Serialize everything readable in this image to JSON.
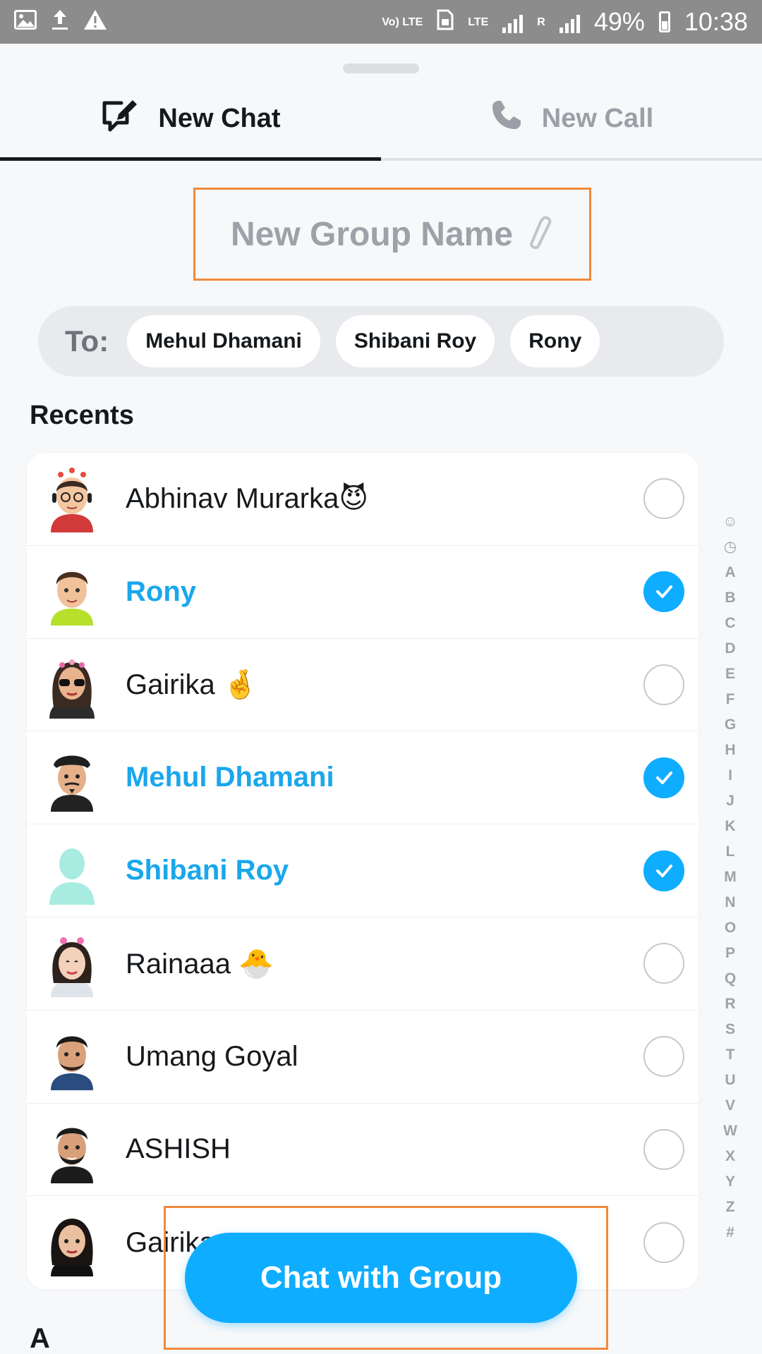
{
  "status_bar": {
    "battery": "49%",
    "time": "10:38",
    "network": "LTE",
    "volte": "Vo) LTE",
    "roaming_marker": "R",
    "left_icons": [
      "image-icon",
      "upload-icon",
      "warning-icon"
    ]
  },
  "tabs": [
    {
      "label": "New Chat",
      "icon": "new-chat-icon",
      "active": true
    },
    {
      "label": "New Call",
      "icon": "phone-icon",
      "active": false
    }
  ],
  "group_name": {
    "placeholder": "New Group Name",
    "icon": "pencil-icon"
  },
  "recipients": {
    "label": "To:",
    "chips": [
      "Mehul Dhamani",
      "Shibani Roy",
      "Rony"
    ]
  },
  "recents": {
    "title": "Recents",
    "contacts": [
      {
        "name": "Abhinav Murarka😈",
        "selected": false
      },
      {
        "name": "Rony",
        "selected": true
      },
      {
        "name": "Gairika 🤞",
        "selected": false
      },
      {
        "name": "Mehul Dhamani",
        "selected": true
      },
      {
        "name": "Shibani Roy",
        "selected": true
      },
      {
        "name": "Rainaaa 🐣",
        "selected": false
      },
      {
        "name": "Umang Goyal",
        "selected": false
      },
      {
        "name": "ASHISH",
        "selected": false
      },
      {
        "name": "Gairika",
        "selected": false
      }
    ]
  },
  "next_section": {
    "title": "A"
  },
  "alphabet_index": [
    "☺",
    "◷",
    "A",
    "B",
    "C",
    "D",
    "E",
    "F",
    "G",
    "H",
    "I",
    "J",
    "K",
    "L",
    "M",
    "N",
    "O",
    "P",
    "Q",
    "R",
    "S",
    "T",
    "U",
    "V",
    "W",
    "X",
    "Y",
    "Z",
    "#"
  ],
  "cta": {
    "label": "Chat with Group"
  },
  "colors": {
    "accent": "#0fadff",
    "selected_text": "#1aa7ec",
    "highlight_box": "#f08a3c"
  }
}
